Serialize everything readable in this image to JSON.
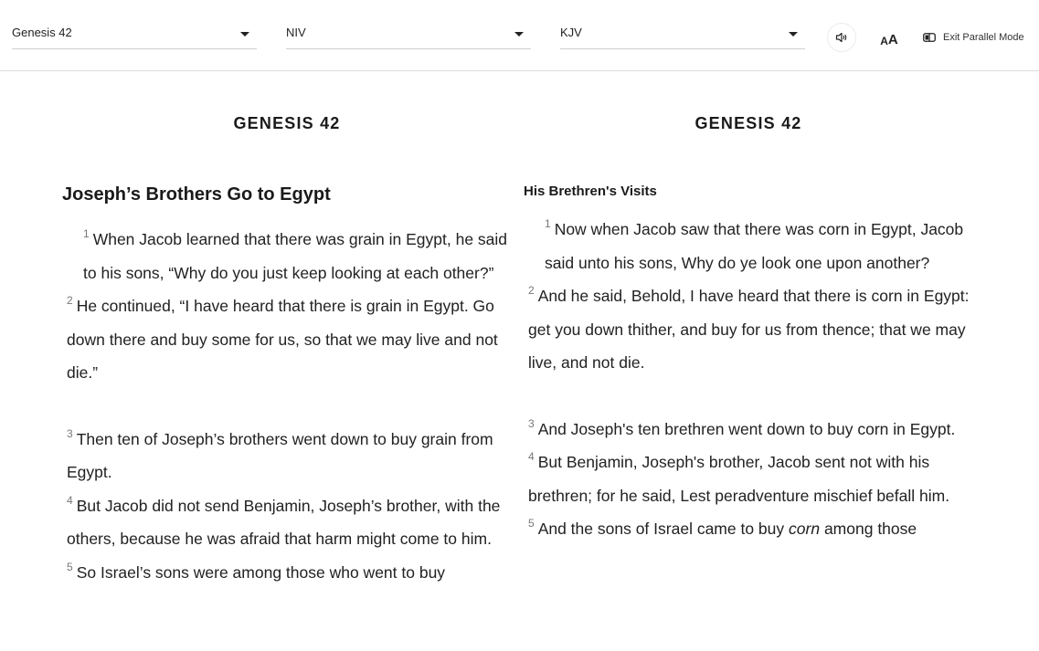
{
  "toolbar": {
    "book_select": {
      "value": "Genesis 42"
    },
    "version_left_select": {
      "value": "NIV"
    },
    "version_right_select": {
      "value": "KJV"
    },
    "audio_button": {
      "icon": "speaker-icon"
    },
    "font_size_button": {
      "label_small": "A",
      "label_large": "A",
      "icon": "font-size-icon"
    },
    "exit_parallel_button": {
      "label": "Exit Parallel Mode",
      "icon": "parallel-columns-icon"
    }
  },
  "left": {
    "version": "NIV",
    "chapter_title": "GENESIS 42",
    "section_heading": "Joseph’s Brothers Go to Egypt",
    "verses": [
      {
        "num": "1",
        "text": "When Jacob learned that there was grain in Egypt, he said to his sons, “Why do you just keep looking at each other?”"
      },
      {
        "num": "2",
        "text": "He continued, “I have heard that there is grain in Egypt. Go down there and buy some for us, so that we may live and not die.”"
      },
      {
        "num": "3",
        "text": "Then ten of Joseph’s brothers went down to buy grain from Egypt."
      },
      {
        "num": "4",
        "text": "But Jacob did not send Benjamin, Joseph’s brother, with the others, because he was afraid that harm might come to him."
      },
      {
        "num": "5",
        "text": "So Israel’s sons were among those who went to buy"
      }
    ]
  },
  "right": {
    "version": "KJV",
    "chapter_title": "GENESIS 42",
    "section_heading": "His Brethren's Visits",
    "verses": [
      {
        "num": "1",
        "text": "Now when Jacob saw that there was corn in Egypt, Jacob said unto his sons, Why do ye look one upon another?"
      },
      {
        "num": "2",
        "text": "And he said, Behold, I have heard that there is corn in Egypt: get you down thither, and buy for us from thence; that we may live, and not die."
      },
      {
        "num": "3",
        "text": "And Joseph's ten brethren went down to buy corn in Egypt."
      },
      {
        "num": "4",
        "text": "But Benjamin, Joseph's brother, Jacob sent not with his brethren; for he said, Lest peradventure mischief befall him."
      },
      {
        "num": "5",
        "text_before": "And the sons of Israel came to buy",
        "text_italic": "corn",
        "text_after": "among those"
      }
    ]
  }
}
